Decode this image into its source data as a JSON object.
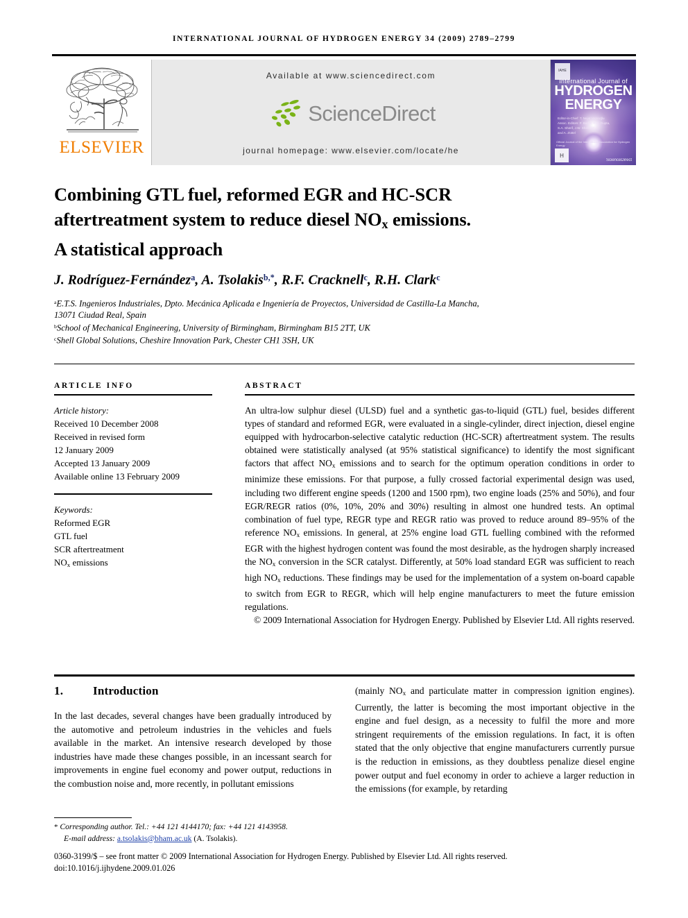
{
  "running_head": "INTERNATIONAL JOURNAL OF HYDROGEN ENERGY 34 (2009) 2789–2799",
  "masthead": {
    "publisher_name": "ELSEVIER",
    "available_at": "Available at www.sciencedirect.com",
    "sciencedirect_word": "ScienceDirect",
    "journal_homepage": "journal homepage: www.elsevier.com/locate/he",
    "cover": {
      "line_small": "International Journal of",
      "line_large_1": "HYDROGEN",
      "line_large_2": "ENERGY",
      "editors": "Editor-in-Chief:  T. Nejat Veziroğlu\nAssoc. Editors:  F. Barbir, R.B. Gupta,\nS.A. Sherif, J.W. Sheffield\nand  A. Züttel",
      "issn_note": "Official Journal of the International Association for Hydrogen Energy",
      "badge_text": "IAHE",
      "sciencedirect_small": "ScienceDirect"
    }
  },
  "title": {
    "line1": "Combining GTL fuel, reformed EGR and HC-SCR",
    "line2_a": "aftertreatment system to reduce diesel NO",
    "line2_sub": "x",
    "line2_b": " emissions.",
    "line3": "A statistical approach"
  },
  "authors": {
    "list": "J. Rodríguez-Fernández",
    "a1": "a",
    "sep1": ", A. Tsolakis",
    "a2": "b,*",
    "sep2": ", R.F. Cracknell",
    "a3": "c",
    "sep3": ", R.H. Clark",
    "a4": "c"
  },
  "affiliations": [
    {
      "mark": "a",
      "text": "E.T.S. Ingenieros Industriales, Dpto. Mecánica Aplicada e Ingeniería de Proyectos, Universidad de Castilla-La Mancha,"
    },
    {
      "mark": "",
      "text": "13071 Ciudad Real, Spain"
    },
    {
      "mark": "b",
      "text": "School of Mechanical Engineering, University of Birmingham, Birmingham B15 2TT, UK"
    },
    {
      "mark": "c",
      "text": "Shell Global Solutions, Cheshire Innovation Park, Chester CH1 3SH, UK"
    }
  ],
  "article_info": {
    "heading": "ARTICLE INFO",
    "history_label": "Article history:",
    "history": [
      "Received 10 December 2008",
      "Received in revised form",
      "12 January 2009",
      "Accepted 13 January 2009",
      "Available online 13 February 2009"
    ],
    "keywords_label": "Keywords:",
    "keywords": [
      "Reformed EGR",
      "GTL fuel",
      "SCR aftertreatment",
      "NOx emissions"
    ],
    "keyword_nox_prefix": "NO",
    "keyword_nox_sub": "x",
    "keyword_nox_suffix": " emissions"
  },
  "abstract": {
    "heading": "ABSTRACT",
    "p1_a": "An ultra-low sulphur diesel (ULSD) fuel and a synthetic gas-to-liquid (GTL) fuel, besides different types of standard and reformed EGR, were evaluated in a single-cylinder, direct injection, diesel engine equipped with hydrocarbon-selective catalytic reduction (HC-SCR) aftertreatment system. The results obtained were statistically analysed (at 95% statistical significance) to identify the most significant factors that affect NO",
    "sub1": "x",
    "p1_b": " emissions and to search for the optimum operation conditions in order to minimize these emissions. For that purpose, a fully crossed factorial experimental design was used, including two different engine speeds (1200 and 1500 rpm), two engine loads (25% and 50%), and four EGR/REGR ratios (0%, 10%, 20% and 30%) resulting in almost one hundred tests. An optimal combination of fuel type, REGR type and REGR ratio was proved to reduce around 89–95% of the reference NO",
    "sub2": "x",
    "p1_c": " emissions. In general, at 25% engine load GTL fuelling combined with the reformed EGR with the highest hydrogen content was found the most desirable, as the hydrogen sharply increased the NO",
    "sub3": "x",
    "p1_d": " conversion in the SCR catalyst. Differently, at 50% load standard EGR was sufficient to reach high NO",
    "sub4": "x",
    "p1_e": " reductions. These findings may be used for the implementation of a system on-board capable to switch from EGR to REGR, which will help engine manufacturers to meet the future emission regulations.",
    "copyright": "© 2009 International Association for Hydrogen Energy. Published by Elsevier Ltd. All rights reserved."
  },
  "section": {
    "number": "1.",
    "name": "Introduction"
  },
  "body": {
    "left": "In the last decades, several changes have been gradually introduced by the automotive and petroleum industries in the vehicles and fuels available in the market. An intensive research developed by those industries have made these changes possible, in an incessant search for improvements in engine fuel economy and power output, reductions in the combustion noise and, more recently, in pollutant emissions",
    "right_a": "(mainly NO",
    "right_sub": "x",
    "right_b": " and particulate matter in compression ignition engines). Currently, the latter is becoming the most important objective in the engine and fuel design, as a necessity to fulfil the more and more stringent requirements of the emission regulations. In fact, it is often stated that the only objective that engine manufacturers currently pursue is the reduction in emissions, as they doubtless penalize diesel engine power output and fuel economy in order to achieve a larger reduction in the emissions (for example, by retarding"
  },
  "footnotes": {
    "star": "*",
    "corresponding": "Corresponding author. Tel.: +44 121 4144170; fax: +44 121 4143958.",
    "email_label": "E-mail address:",
    "email": "a.tsolakis@bham.ac.uk",
    "email_suffix": "(A. Tsolakis).",
    "front_matter": "0360-3199/$ – see front matter © 2009 International Association for Hydrogen Energy. Published by Elsevier Ltd. All rights reserved.",
    "doi": "doi:10.1016/j.ijhydene.2009.01.026"
  },
  "colors": {
    "elsevier_orange": "#F07D00",
    "sciencedirect_grey": "#8a8a8a",
    "sciencedirect_green": "#7AB317",
    "banner_bg": "#e9e9e9",
    "link_blue": "#1b3ea8",
    "superscript_blue": "#1b2a6b"
  }
}
